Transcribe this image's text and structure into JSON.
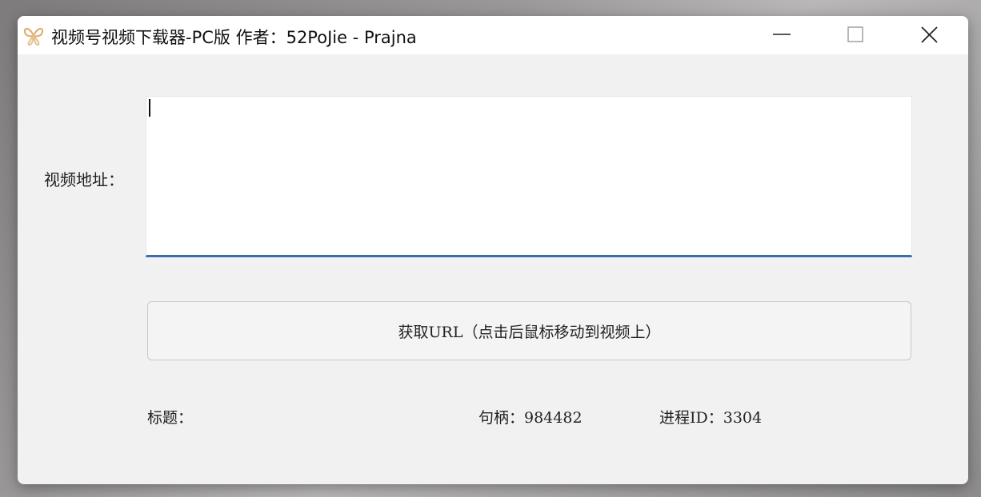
{
  "window": {
    "title": "视频号视频下载器-PC版   作者：52PoJie - Prajna",
    "controls": {
      "minimize": "minimize-icon",
      "maximize": "maximize-icon",
      "close": "close-icon"
    }
  },
  "form": {
    "url_label": "视频地址：",
    "url_value": "",
    "get_url_button": "获取URL（点击后鼠标移动到视频上）"
  },
  "status": {
    "title_label": "标题：",
    "handle_text": "句柄：984482",
    "pid_text": "进程ID：3304"
  },
  "colors": {
    "accent": "#3d6cb3",
    "window_bg": "#f1f1f1",
    "titlebar_bg": "#ffffff"
  }
}
